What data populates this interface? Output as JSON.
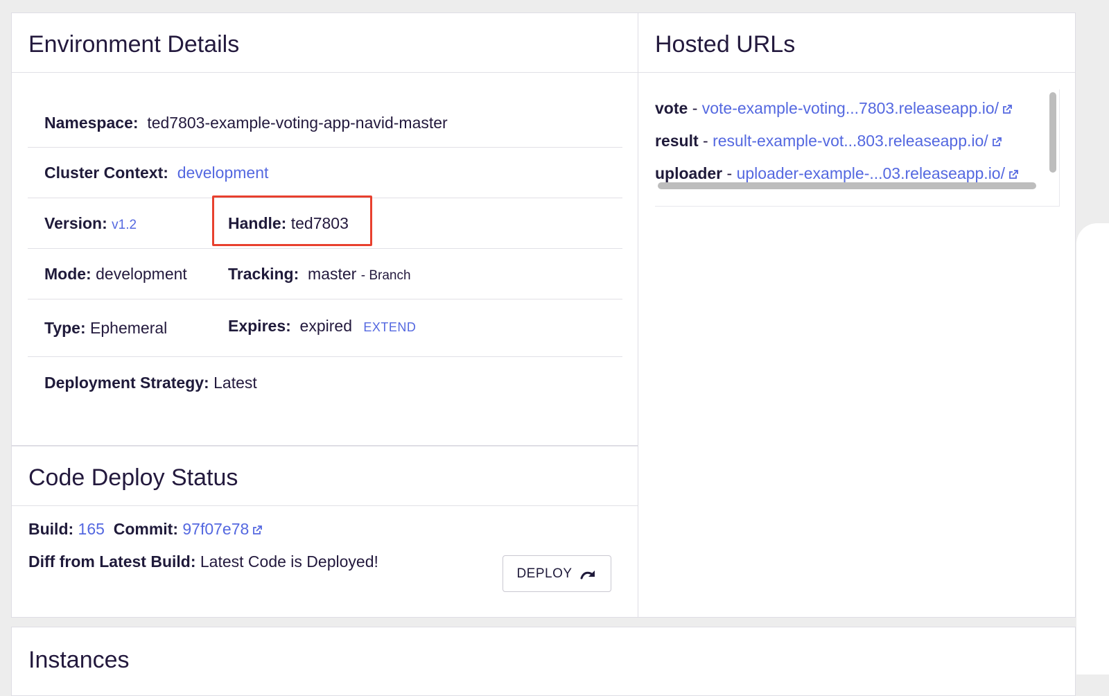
{
  "environment": {
    "title": "Environment Details",
    "namespace_label": "Namespace:",
    "namespace_value": "ted7803-example-voting-app-navid-master",
    "cluster_label": "Cluster Context:",
    "cluster_value": "development",
    "version_label": "Version:",
    "version_value": "v1.2",
    "handle_label": "Handle:",
    "handle_value": "ted7803",
    "mode_label": "Mode:",
    "mode_value": "development",
    "tracking_label": "Tracking:",
    "tracking_value": "master",
    "tracking_suffix": "- Branch",
    "type_label": "Type:",
    "type_value": "Ephemeral",
    "expires_label": "Expires:",
    "expires_value": "expired",
    "extend_label": "EXTEND",
    "strategy_label": "Deployment Strategy:",
    "strategy_value": "Latest"
  },
  "code_deploy": {
    "title": "Code Deploy Status",
    "build_label": "Build:",
    "build_value": "165",
    "commit_label": "Commit:",
    "commit_value": "97f07e78",
    "diff_label": "Diff from Latest Build:",
    "diff_value": "Latest Code is Deployed!",
    "deploy_button": "DEPLOY"
  },
  "hosted_urls": {
    "title": "Hosted URLs",
    "items": [
      {
        "name": "vote",
        "sep": "-",
        "url": "vote-example-voting...7803.releaseapp.io/"
      },
      {
        "name": "result",
        "sep": "-",
        "url": "result-example-vot...803.releaseapp.io/"
      },
      {
        "name": "uploader",
        "sep": "-",
        "url": "uploader-example-...03.releaseapp.io/"
      }
    ]
  },
  "instances": {
    "title": "Instances"
  },
  "colors": {
    "link": "#5468e0",
    "highlight": "#e8402e",
    "text": "#1f1a3a"
  }
}
